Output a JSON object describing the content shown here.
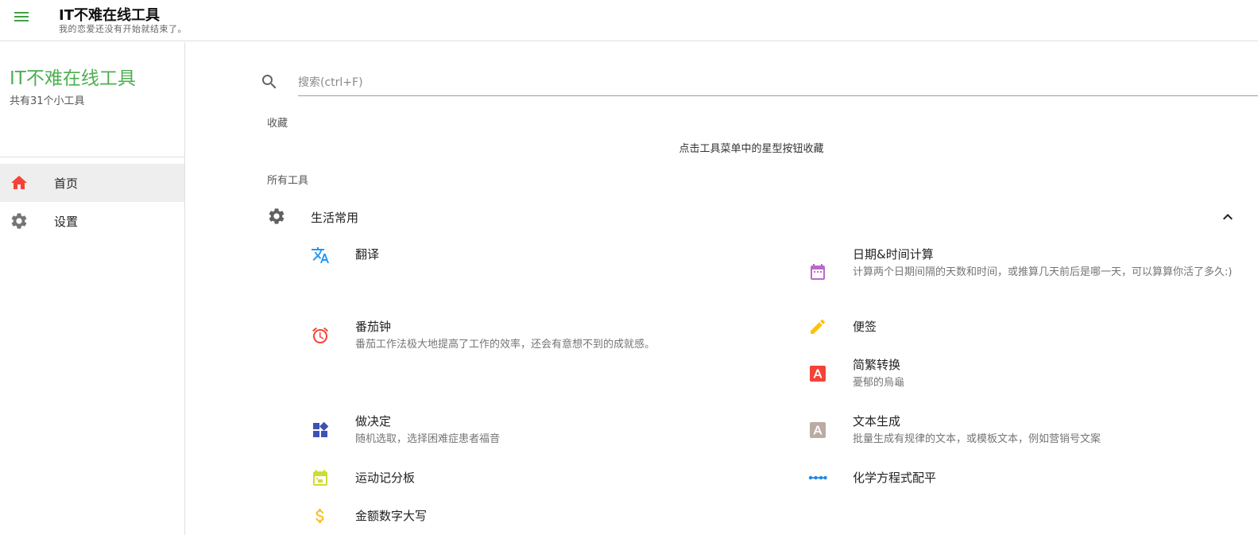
{
  "header": {
    "title": "IT不难在线工具",
    "subtitle": "我的恋爱还没有开始就结束了。",
    "menu_icon": "hamburger-menu-icon"
  },
  "sidebar": {
    "title": "IT不难在线工具",
    "count_text": "共有31个小工具",
    "items": [
      {
        "label": "首页",
        "icon": "home-icon",
        "active": true
      },
      {
        "label": "设置",
        "icon": "gear-icon",
        "active": false
      }
    ]
  },
  "search": {
    "placeholder": "搜索(ctrl+F)",
    "value": ""
  },
  "favorites": {
    "label": "收藏",
    "hint": "点击工具菜单中的星型按钮收藏"
  },
  "all_tools": {
    "label": "所有工具",
    "category": {
      "label": "生活常用",
      "icon": "gear-icon",
      "expanded": true
    },
    "tools": [
      {
        "name": "翻译",
        "desc": "",
        "icon": "translate-icon",
        "color": "#2196f3"
      },
      {
        "name": "日期&时间计算",
        "desc": "计算两个日期间隔的天数和时间，或推算几天前后是哪一天，可以算算你活了多久:)",
        "icon": "calendar-icon",
        "color": "#ba68c8"
      },
      {
        "name": "番茄钟",
        "desc": "番茄工作法极大地提高了工作的效率，还会有意想不到的成就感。",
        "icon": "alarm-clock-icon",
        "color": "#f44336"
      },
      {
        "name": "便签",
        "desc": "",
        "icon": "pencil-icon",
        "color": "#ffc107"
      },
      {
        "name": "简繁转换",
        "desc": "憂郁的烏龜",
        "icon": "font-box-icon",
        "color": "#f44336"
      },
      {
        "name": "做决定",
        "desc": "随机选取，选择困难症患者福音",
        "icon": "widgets-icon",
        "color": "#3f51b5"
      },
      {
        "name": "文本生成",
        "desc": "批量生成有规律的文本，或模板文本，例如营销号文案",
        "icon": "font-box-icon",
        "color": "#bcaaa4"
      },
      {
        "name": "运动记分板",
        "desc": "",
        "icon": "calendar-today-icon",
        "color": "#cddc39"
      },
      {
        "name": "化学方程式配平",
        "desc": "",
        "icon": "molecule-chain-icon",
        "color": "#1e88e5"
      },
      {
        "name": "金额数字大写",
        "desc": "",
        "icon": "dollar-icon",
        "color": "#fbc02d"
      }
    ]
  }
}
